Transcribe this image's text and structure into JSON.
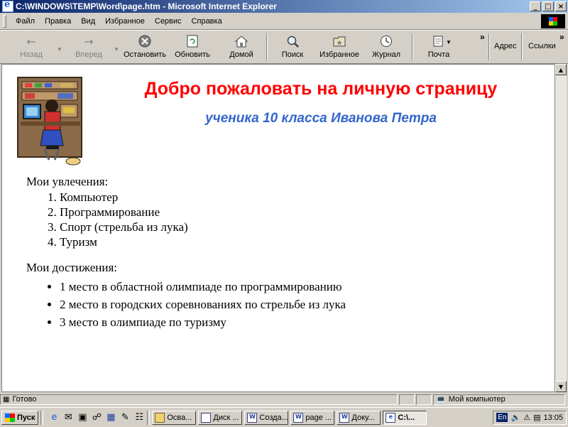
{
  "window": {
    "title": "C:\\WINDOWS\\TEMP\\Word\\page.htm - Microsoft Internet Explorer",
    "buttons": [
      "_",
      "□",
      "×"
    ]
  },
  "menubar": {
    "items": [
      "Файл",
      "Правка",
      "Вид",
      "Избранное",
      "Сервис",
      "Справка"
    ]
  },
  "toolbar": {
    "back": "Назад",
    "forward": "Вперед",
    "stop": "Остановить",
    "refresh": "Обновить",
    "home": "Домой",
    "search": "Поиск",
    "favorites": "Избранное",
    "history": "Журнал",
    "mail": "Почта",
    "chevron": "»",
    "address": "Адрес",
    "links": "Ссылки"
  },
  "page": {
    "heading": "Добро пожаловать на личную страницу",
    "subheading": "ученика 10 класса Иванова Петра",
    "hobbies_title": "Мои увлечения:",
    "hobbies": [
      "Компьютер",
      "Программирование",
      "Спорт (стрельба из лука)",
      "Туризм"
    ],
    "achievements_title": "Мои достижения:",
    "achievements": [
      "1 место в областной олимпиаде по программированию",
      "2 место в городских соревнованиях по стрельбе из лука",
      "3 место в олимпиаде по туризму"
    ]
  },
  "statusbar": {
    "status": "Готово",
    "zone": "Мой компьютер"
  },
  "taskbar": {
    "start": "Пуск",
    "tasks": [
      "Осва...",
      "Диск ...",
      "Созда...",
      "page ...",
      "Доку...",
      "C:\\..."
    ],
    "lang": "En",
    "clock": "13:05"
  }
}
